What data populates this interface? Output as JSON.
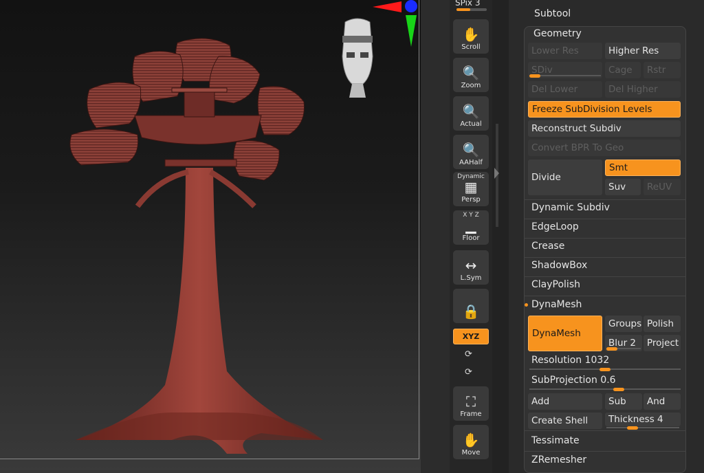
{
  "colors": {
    "accent": "#f7931e",
    "panel_bg": "#2a2a2a",
    "button_bg": "#3d3d3d",
    "tree": "#8a3a32"
  },
  "shelf": {
    "spix_label": "SPix 3",
    "buttons": [
      {
        "label": "Scroll",
        "icon": "hand-scroll-icon",
        "glyph": "✋"
      },
      {
        "label": "Zoom",
        "icon": "magnifier-zoom-icon",
        "glyph": "🔍"
      },
      {
        "label": "Actual",
        "icon": "magnifier-actual-icon",
        "glyph": "🔍"
      },
      {
        "label": "AAHalf",
        "icon": "magnifier-aahalf-icon",
        "glyph": "🔍"
      },
      {
        "label": "Persp",
        "icon": "perspective-grid-icon",
        "glyph": "▦",
        "top_label": "Dynamic"
      },
      {
        "label": "Floor",
        "icon": "floor-grid-icon",
        "glyph": "▁",
        "top_label": "X Y Z"
      },
      {
        "label": "L.Sym",
        "icon": "local-symmetry-icon",
        "glyph": "↔"
      },
      {
        "label": "",
        "icon": "camera-lock-icon",
        "glyph": "🔒"
      },
      {
        "label": "Frame",
        "icon": "frame-icon",
        "glyph": "⛶"
      },
      {
        "label": "Move",
        "icon": "hand-move-icon",
        "glyph": "✋"
      }
    ],
    "xyz_label": "XYZ",
    "y_rotate_icon": "⟳",
    "z_rotate_icon": "⟳"
  },
  "panel": {
    "subtool_title": "Subtool",
    "geometry_title": "Geometry",
    "lower_res": "Lower Res",
    "higher_res": "Higher Res",
    "sdiv": "SDiv",
    "cage": "Cage",
    "rstr": "Rstr",
    "del_lower": "Del Lower",
    "del_higher": "Del Higher",
    "freeze": "Freeze SubDivision Levels",
    "reconstruct": "Reconstruct Subdiv",
    "convert_bpr": "Convert BPR To Geo",
    "divide": "Divide",
    "smt": "Smt",
    "suv": "Suv",
    "reuv": "ReUV",
    "sections": [
      "Dynamic Subdiv",
      "EdgeLoop",
      "Crease",
      "ShadowBox",
      "ClayPolish"
    ],
    "dynamesh_section": "DynaMesh",
    "dynamesh_button": "DynaMesh",
    "groups": "Groups",
    "polish": "Polish",
    "blur": "Blur 2",
    "project": "Project",
    "resolution": "Resolution 1032",
    "resolution_value": 1032,
    "subprojection": "SubProjection 0.6",
    "subprojection_value": 0.6,
    "add": "Add",
    "sub": "Sub",
    "and": "And",
    "create_shell": "Create Shell",
    "thickness": "Thickness 4",
    "tessimate": "Tessimate",
    "zremesher": "ZRemesher"
  }
}
